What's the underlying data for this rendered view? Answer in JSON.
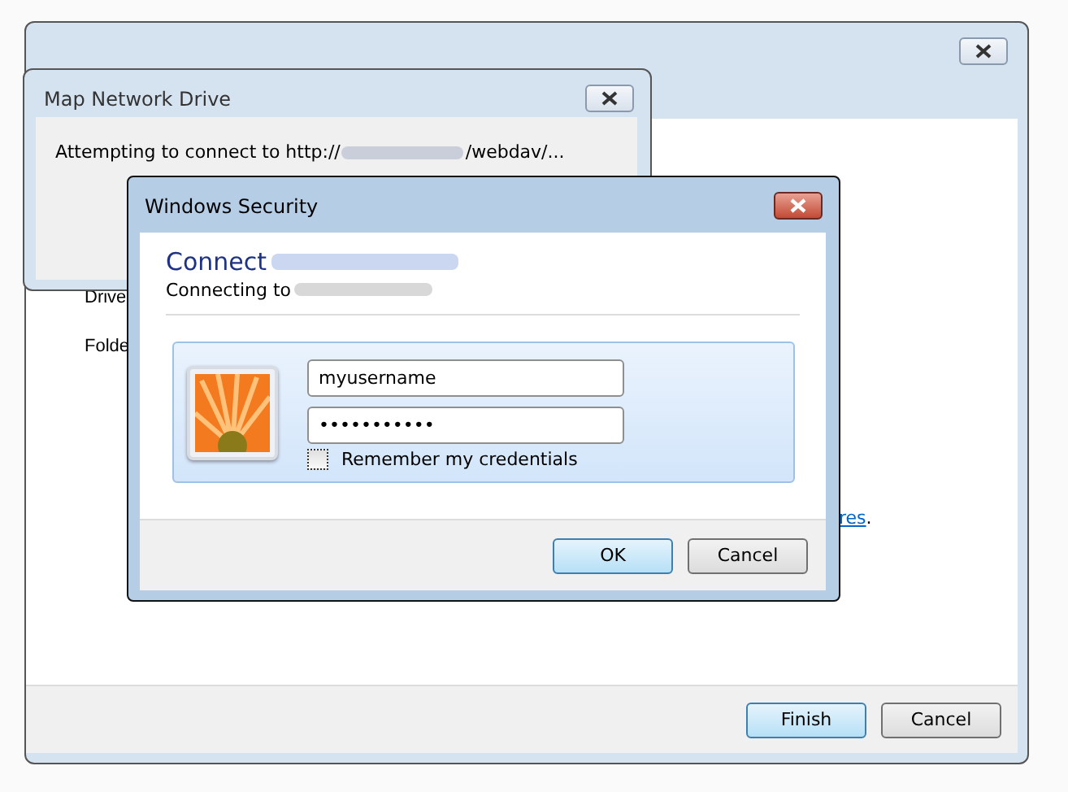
{
  "wizard": {
    "labels": [
      "Drive",
      "Folde"
    ],
    "link": "res",
    "link_suffix": ".",
    "buttons": [
      {
        "label": "Finish",
        "default": true
      },
      {
        "label": "Cancel",
        "default": false
      }
    ]
  },
  "progress_dialog": {
    "title": "Map Network Drive",
    "message_start": "Attempting to connect to http://",
    "message_end": "/webdav/..."
  },
  "security_dialog": {
    "title": "Windows Security",
    "heading": "Connect",
    "subheading": "Connecting to",
    "username": "myusername",
    "password": "•••••••••••",
    "remember": {
      "label": "Remember my credentials",
      "checked": false
    },
    "buttons": [
      {
        "label": "OK",
        "default": true
      },
      {
        "label": "Cancel",
        "default": false
      }
    ]
  }
}
